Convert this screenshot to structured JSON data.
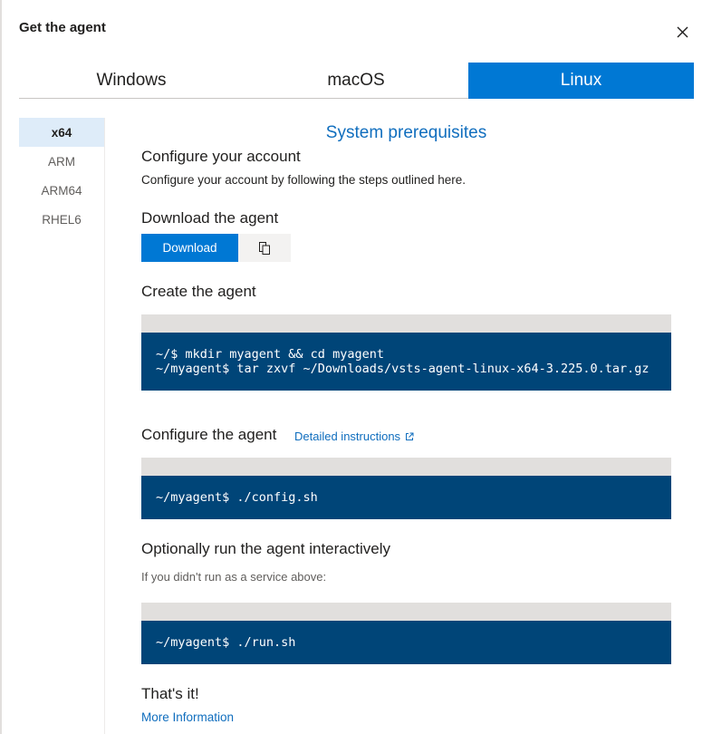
{
  "dialog": {
    "title": "Get the agent",
    "close_icon": "close-icon"
  },
  "os_tabs": [
    {
      "label": "Windows",
      "active": false
    },
    {
      "label": "macOS",
      "active": false
    },
    {
      "label": "Linux",
      "active": true
    }
  ],
  "arch_tabs": [
    {
      "label": "x64",
      "active": true
    },
    {
      "label": "ARM",
      "active": false
    },
    {
      "label": "ARM64",
      "active": false
    },
    {
      "label": "RHEL6",
      "active": false
    }
  ],
  "content": {
    "prerequisites_link": "System prerequisites",
    "configure_account": {
      "title": "Configure your account",
      "text": "Configure your account by following the steps outlined here."
    },
    "download_agent": {
      "title": "Download the agent",
      "download_label": "Download",
      "copy_icon": "copy-icon"
    },
    "create_agent": {
      "title": "Create the agent",
      "code": "~/$ mkdir myagent && cd myagent\n~/myagent$ tar zxvf ~/Downloads/vsts-agent-linux-x64-3.225.0.tar.gz"
    },
    "configure_agent": {
      "title": "Configure the agent",
      "link": "Detailed instructions",
      "link_icon": "external-link-icon",
      "code": "~/myagent$ ./config.sh"
    },
    "run_agent": {
      "title": "Optionally run the agent interactively",
      "note": "If you didn't run as a service above:",
      "code": "~/myagent$ ./run.sh"
    },
    "done": {
      "title": "That's it!",
      "link": "More Information"
    }
  },
  "colors": {
    "accent": "#0078d4",
    "code_bg": "#004578",
    "link": "#106ebe"
  }
}
